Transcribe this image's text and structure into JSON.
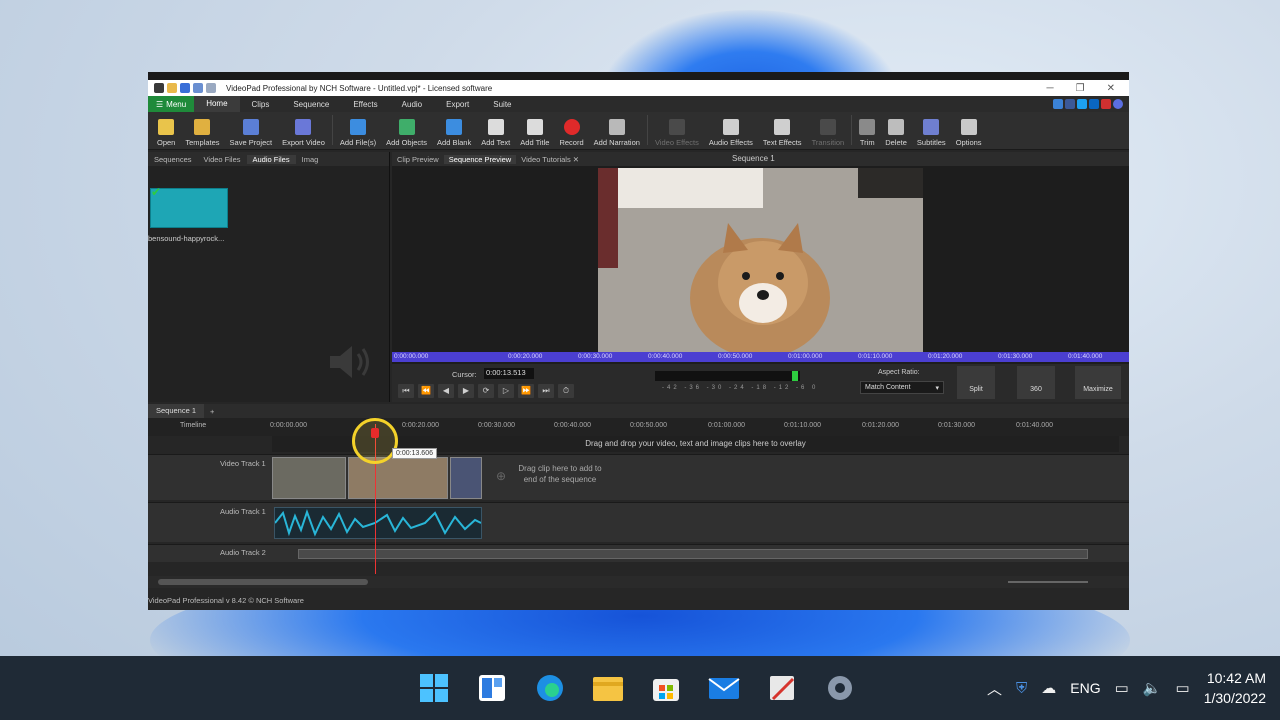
{
  "window": {
    "title": "VideoPad Professional by NCH Software - Untitled.vpj* - Licensed software",
    "controls": [
      "─",
      "❐",
      "✕"
    ]
  },
  "menubar": {
    "menu_label": "Menu",
    "tabs": [
      "Home",
      "Clips",
      "Sequence",
      "Effects",
      "Audio",
      "Export",
      "Suite"
    ]
  },
  "toolbar": {
    "items": [
      "Open",
      "Templates",
      "Save Project",
      "Export Video",
      "Add File(s)",
      "Add Objects",
      "Add Blank",
      "Add Text",
      "Add Title",
      "Record",
      "Add Narration",
      "Video Effects",
      "Audio Effects",
      "Text Effects",
      "Transition",
      "Trim",
      "Delete",
      "Subtitles",
      "Options"
    ]
  },
  "media_panel": {
    "tabs": [
      "Sequences",
      "Video Files",
      "Audio Files",
      "Imag"
    ],
    "file_label": "bensound-happyrock..."
  },
  "preview_panel": {
    "tabs": [
      "Clip Preview",
      "Sequence Preview",
      "Video Tutorials ✕"
    ],
    "sequence_title": "Sequence 1",
    "ruler_ticks": [
      "0:00:00.000",
      "0:00:20.000",
      "0:00:30.000",
      "0:00:40.000",
      "0:00:50.000",
      "0:01:00.000",
      "0:01:10.000",
      "0:01:20.000",
      "0:01:30.000",
      "0:01:40.000"
    ],
    "cursor_label": "Cursor:",
    "cursor_value": "0:00:13.513",
    "meter_scale": "-42 -36 -30 -24 -18 -12 -6 0",
    "aspect_label": "Aspect Ratio:",
    "aspect_value": "Match Content",
    "split_label": "Split",
    "btn_360": "360",
    "maximize_label": "Maximize"
  },
  "timeline": {
    "tab": "Sequence 1",
    "label": "Timeline",
    "ruler_ticks": [
      "0:00:00.000",
      "0:00:20.000",
      "0:00:30.000",
      "0:00:40.000",
      "0:00:50.000",
      "0:01:00.000",
      "0:01:10.000",
      "0:01:20.000",
      "0:01:30.000",
      "0:01:40.000"
    ],
    "tooltip": "0:00:13.606",
    "overlay_hint": "Drag and drop your video, text and image clips here to overlay",
    "video_track": "Video Track 1",
    "drop_hint": "Drag clip here to add to end of the sequence",
    "audio_track_1": "Audio Track 1",
    "audio_track_2": "Audio Track 2"
  },
  "status": {
    "text": "VideoPad Professional v 8.42 © NCH Software"
  },
  "taskbar": {
    "language": "ENG",
    "time": "10:42 AM",
    "date": "1/30/2022"
  }
}
